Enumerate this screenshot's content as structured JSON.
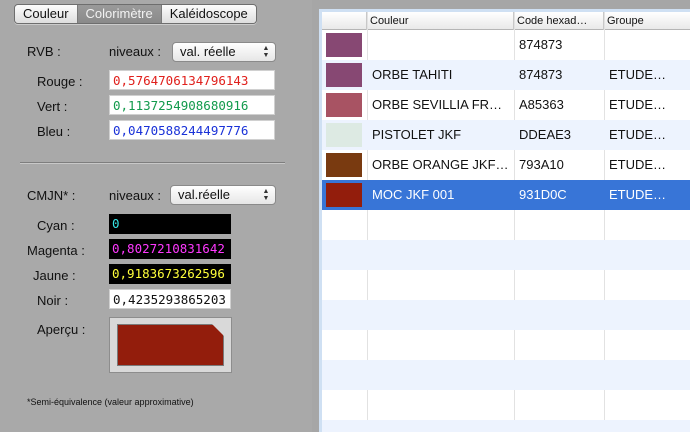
{
  "tabs": [
    {
      "label": "Couleur",
      "active": false
    },
    {
      "label": "Colorimètre",
      "active": true
    },
    {
      "label": "Kaléidoscope",
      "active": false
    }
  ],
  "rvb": {
    "label": "RVB :",
    "niveaux_label": "niveaux :",
    "select_value": "val. réelle",
    "rouge_label": "Rouge :",
    "rouge_value": "0,5764706134796143",
    "vert_label": "Vert :",
    "vert_value": "0,1137254908680916",
    "bleu_label": "Bleu :",
    "bleu_value": "0,0470588244497776"
  },
  "cmjn": {
    "label": "CMJN* :",
    "niveaux_label": "niveaux :",
    "select_value": "val.réelle",
    "cyan_label": "Cyan :",
    "cyan_value": "0",
    "magenta_label": "Magenta :",
    "magenta_value": "0,8027210831642",
    "jaune_label": "Jaune :",
    "jaune_value": "0,9183673262596",
    "noir_label": "Noir :",
    "noir_value": "0,4235293865203"
  },
  "apercu": {
    "label": "Aperçu :",
    "color": "#931D0C"
  },
  "footnote": "*Semi-équivalence (valeur approximative)",
  "colors": {
    "rouge_text": "#e0201c",
    "vert_text": "#129a4c",
    "bleu_text": "#1a32d8",
    "cyan_text": "#37e6e6",
    "magenta_text": "#ff38ff",
    "jaune_text": "#ffff3a",
    "noir_text": "#111111",
    "selection": "#3875d7"
  },
  "table": {
    "headers": [
      "Couleur",
      "Code hexad…",
      "Groupe"
    ],
    "rows": [
      {
        "swatch": "#874873",
        "name": "",
        "code": "874873",
        "group": ""
      },
      {
        "swatch": "#874873",
        "name": "ORBE TAHITI",
        "code": "874873",
        "group": "ETUDE…"
      },
      {
        "swatch": "#A85363",
        "name": "ORBE SEVILLIA FR…",
        "code": "A85363",
        "group": "ETUDE…"
      },
      {
        "swatch": "#DDEAE3",
        "name": "PISTOLET JKF",
        "code": "DDEAE3",
        "group": "ETUDE…"
      },
      {
        "swatch": "#793A10",
        "name": "ORBE ORANGE JKF…",
        "code": "793A10",
        "group": "ETUDE…"
      },
      {
        "swatch": "#931D0C",
        "name": "MOC JKF 001",
        "code": "931D0C",
        "group": "ETUDE…",
        "selected": true
      }
    ]
  }
}
